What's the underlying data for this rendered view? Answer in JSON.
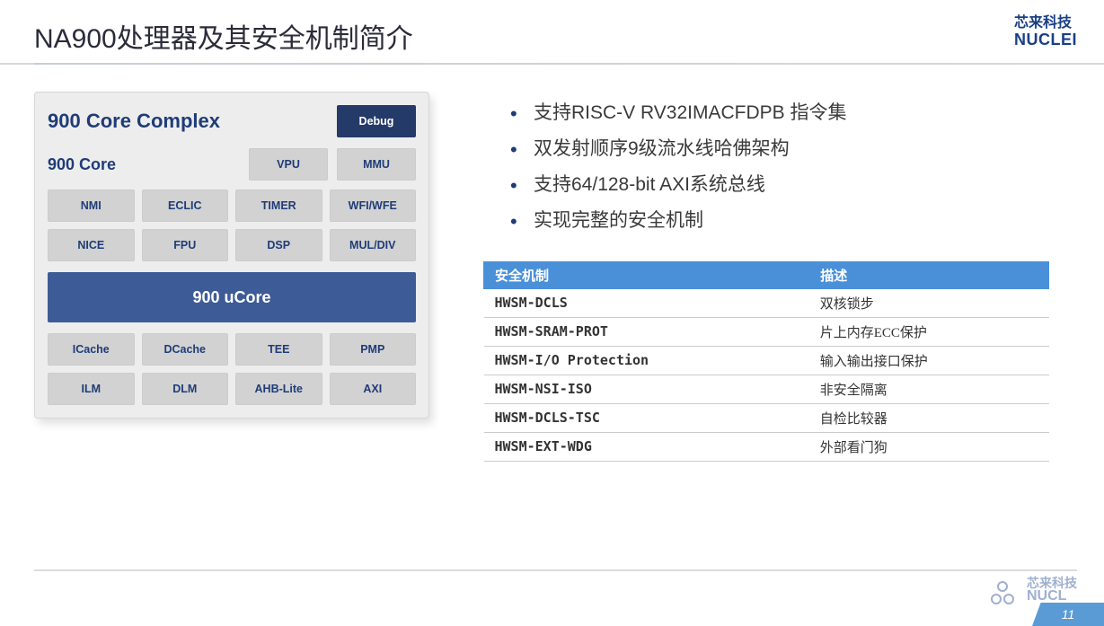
{
  "header": {
    "title": "NA900处理器及其安全机制简介",
    "brand_cn": "芯来科技",
    "brand_en": "NUCLEI"
  },
  "diagram": {
    "complex_title": "900 Core Complex",
    "debug": "Debug",
    "core_label": "900 Core",
    "row1": [
      "VPU",
      "MMU"
    ],
    "row2": [
      "NMI",
      "ECLIC",
      "TIMER",
      "WFI/WFE"
    ],
    "row3": [
      "NICE",
      "FPU",
      "DSP",
      "MUL/DIV"
    ],
    "ucore": "900 uCore",
    "row4": [
      "ICache",
      "DCache",
      "TEE",
      "PMP"
    ],
    "row5": [
      "ILM",
      "DLM",
      "AHB-Lite",
      "AXI"
    ]
  },
  "bullets": [
    "支持RISC-V RV32IMACFDPB 指令集",
    "双发射顺序9级流水线哈佛架构",
    "支持64/128-bit AXI系统总线",
    "实现完整的安全机制"
  ],
  "table": {
    "headers": [
      "安全机制",
      "描述"
    ],
    "rows": [
      [
        "HWSM-DCLS",
        "双核锁步"
      ],
      [
        "HWSM-SRAM-PROT",
        "片上内存ECC保护"
      ],
      [
        "HWSM-I/O Protection",
        "输入输出接口保护"
      ],
      [
        "HWSM-NSI-ISO",
        "非安全隔离"
      ],
      [
        "HWSM-DCLS-TSC",
        "自检比较器"
      ],
      [
        "HWSM-EXT-WDG",
        "外部看门狗"
      ]
    ]
  },
  "footer": {
    "brand_cn": "芯来科技",
    "brand_en": "NUCL",
    "page": "11"
  }
}
